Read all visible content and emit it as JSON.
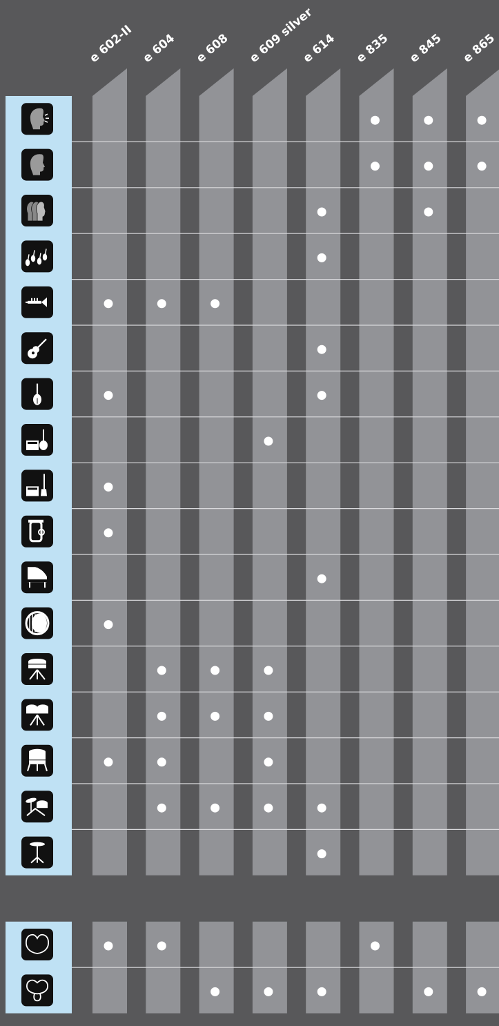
{
  "chart_data": {
    "type": "table",
    "columns": [
      "e 602-II",
      "e 604",
      "e 608",
      "e 609 silver",
      "e 614",
      "e 835",
      "e 845",
      "e 865"
    ],
    "application_rows": [
      {
        "icon": "lead-vocals-icon",
        "marks": [
          0,
          0,
          0,
          0,
          0,
          1,
          1,
          1
        ]
      },
      {
        "icon": "backing-vocals-icon",
        "marks": [
          0,
          0,
          0,
          0,
          0,
          1,
          1,
          1
        ]
      },
      {
        "icon": "choir-icon",
        "marks": [
          0,
          0,
          0,
          0,
          1,
          0,
          1,
          0
        ]
      },
      {
        "icon": "string-section-icon",
        "marks": [
          0,
          0,
          0,
          0,
          1,
          0,
          0,
          0
        ]
      },
      {
        "icon": "trumpet-icon",
        "marks": [
          1,
          1,
          1,
          0,
          0,
          0,
          0,
          0
        ]
      },
      {
        "icon": "acoustic-guitar-icon",
        "marks": [
          0,
          0,
          0,
          0,
          1,
          0,
          0,
          0
        ]
      },
      {
        "icon": "violin-icon",
        "marks": [
          1,
          0,
          0,
          0,
          1,
          0,
          0,
          0
        ]
      },
      {
        "icon": "guitar-amp-icon",
        "marks": [
          0,
          0,
          0,
          1,
          0,
          0,
          0,
          0
        ]
      },
      {
        "icon": "bass-amp-icon",
        "marks": [
          1,
          0,
          0,
          0,
          0,
          0,
          0,
          0
        ]
      },
      {
        "icon": "tuba-icon",
        "marks": [
          1,
          0,
          0,
          0,
          0,
          0,
          0,
          0
        ]
      },
      {
        "icon": "piano-icon",
        "marks": [
          0,
          0,
          0,
          0,
          1,
          0,
          0,
          0
        ]
      },
      {
        "icon": "bass-drum-icon",
        "marks": [
          1,
          0,
          0,
          0,
          0,
          0,
          0,
          0
        ]
      },
      {
        "icon": "snare-drum-icon",
        "marks": [
          0,
          1,
          1,
          1,
          0,
          0,
          0,
          0
        ]
      },
      {
        "icon": "toms-icon",
        "marks": [
          0,
          1,
          1,
          1,
          0,
          0,
          0,
          0
        ]
      },
      {
        "icon": "floor-tom-icon",
        "marks": [
          1,
          1,
          0,
          1,
          0,
          0,
          0,
          0
        ]
      },
      {
        "icon": "drum-kit-icon",
        "marks": [
          0,
          1,
          1,
          1,
          1,
          0,
          0,
          0
        ]
      },
      {
        "icon": "cymbal-icon",
        "marks": [
          0,
          0,
          0,
          0,
          1,
          0,
          0,
          0
        ]
      }
    ],
    "polar_rows": [
      {
        "icon": "cardioid-pattern-icon",
        "marks": [
          1,
          1,
          0,
          0,
          0,
          1,
          0,
          0
        ]
      },
      {
        "icon": "supercardioid-pattern-icon",
        "marks": [
          0,
          0,
          1,
          1,
          1,
          0,
          1,
          1
        ]
      }
    ]
  },
  "colors": {
    "background": "#58585a",
    "column": "#929397",
    "sidebar": "#bfe1f4",
    "icon_tile": "#111111",
    "dot": "#ffffff",
    "divider": "#d9d9dc"
  }
}
